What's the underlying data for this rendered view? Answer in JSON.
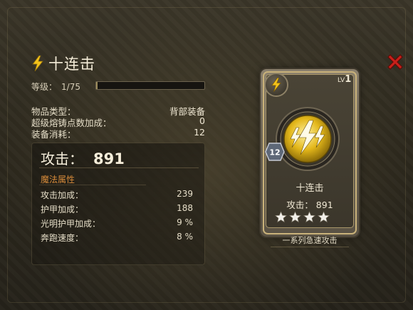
{
  "skill": {
    "name": "十连击",
    "level_label": "等级：",
    "level_value": "1/75",
    "level_progress": 0.0133
  },
  "info": {
    "item_type_label": "物品类型：",
    "item_type_value": "背部装备",
    "fusion_bonus_label": "超级熔铸点数加成：",
    "fusion_bonus_value": "0",
    "equip_cost_label": "装备消耗：",
    "equip_cost_value": "12"
  },
  "stats": {
    "attack_label": "攻击：",
    "attack_value": "891",
    "magic_section_title": "魔法属性",
    "rows": [
      {
        "label": "攻击加成：",
        "value": "239"
      },
      {
        "label": "护甲加成：",
        "value": "188"
      },
      {
        "label": "光明护甲加成：",
        "value": "9 %"
      },
      {
        "label": "奔跑速度：",
        "value": "8 %"
      }
    ]
  },
  "card": {
    "level_text": "1",
    "level_prefix": "LV",
    "cost": "12",
    "name": "十连击",
    "attack_text": "攻击： 891",
    "stars": 4,
    "description": "一系列急速攻击"
  },
  "icons": {
    "bolt": "lightning-bolt-icon",
    "close": "close-icon",
    "star": "star-icon"
  },
  "colors": {
    "bolt_yellow": "#f2c21b",
    "close_red": "#c8201a",
    "magic_orange": "#d68a3a"
  }
}
